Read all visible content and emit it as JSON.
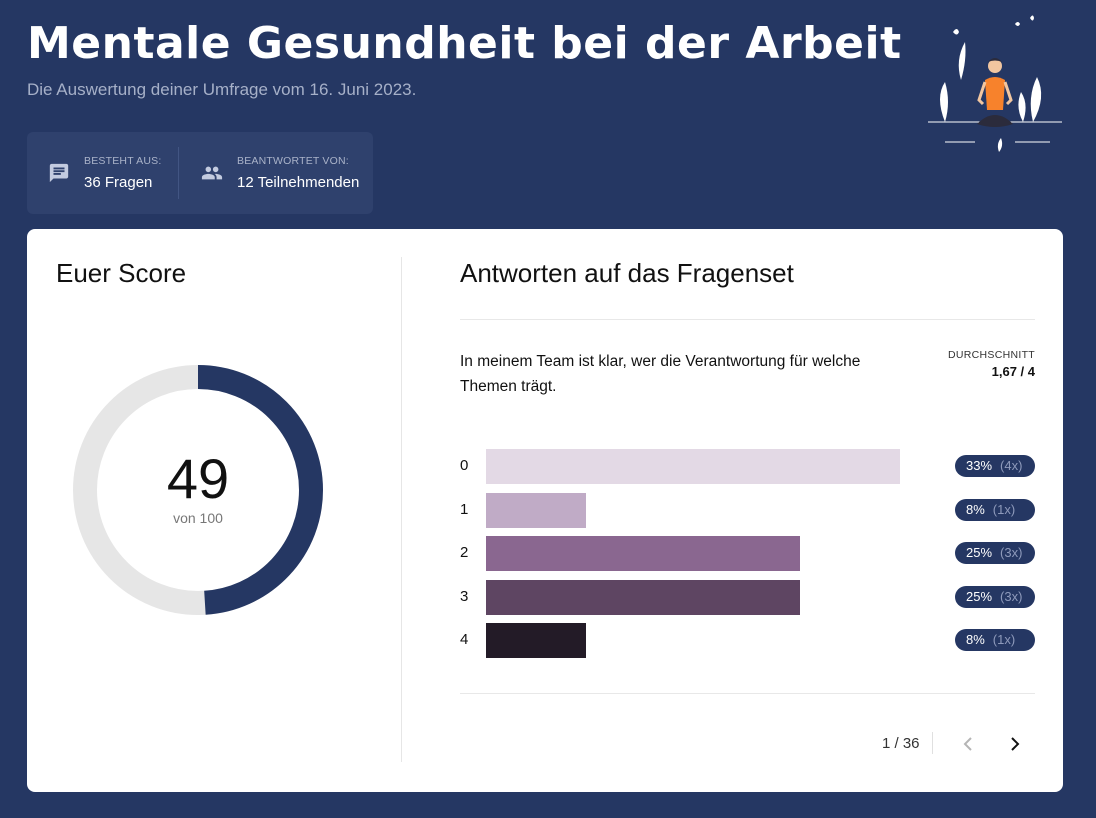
{
  "header": {
    "title": "Mentale Gesundheit bei der Arbeit",
    "subtitle": "Die Auswertung deiner Umfrage vom 16. Juni 2023."
  },
  "info": {
    "questions_label": "BESTEHT AUS:",
    "questions_value": "36 Fragen",
    "participants_label": "BEANTWORTET VON:",
    "participants_value": "12 Teilnehmenden",
    "questions_icon": "chat-icon",
    "participants_icon": "people-icon"
  },
  "score": {
    "heading": "Euer Score",
    "value": "49",
    "value_number": 49,
    "max_label": "von 100",
    "max": 100
  },
  "answers": {
    "heading": "Antworten auf das Fragenset",
    "question": "In meinem Team ist klar, wer die Verantwortung für welche Themen trägt.",
    "average_label": "DURCHSCHNITT",
    "average_value": "1,67 / 4",
    "pagination": "1 / 36"
  },
  "chart_data": {
    "type": "bar",
    "orientation": "horizontal",
    "categories": [
      "0",
      "1",
      "2",
      "3",
      "4"
    ],
    "values": [
      33,
      8,
      25,
      25,
      8
    ],
    "counts": [
      4,
      1,
      3,
      3,
      1
    ],
    "percent_labels": [
      "33%",
      "8%",
      "25%",
      "25%",
      "8%"
    ],
    "count_labels": [
      "(4x)",
      "(1x)",
      "(3x)",
      "(3x)",
      "(1x)"
    ],
    "colors": [
      "#e3d9e5",
      "#c0abc6",
      "#8a6790",
      "#5e4562",
      "#231b27"
    ],
    "xlim": [
      0,
      33
    ]
  },
  "colors": {
    "background": "#253763",
    "accent": "#253763",
    "illustration_accent": "#f7822c"
  }
}
